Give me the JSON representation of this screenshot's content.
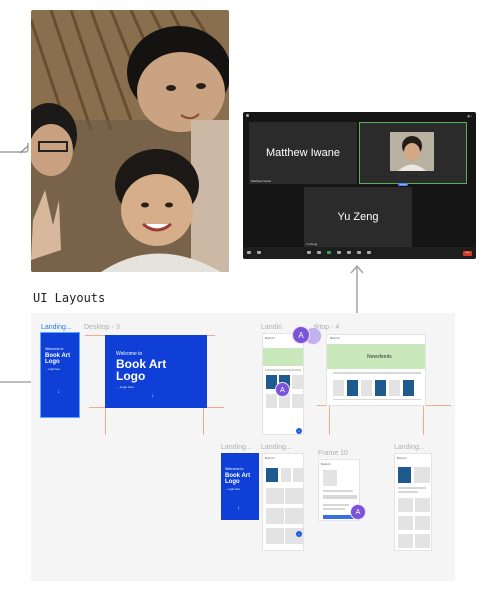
{
  "zoom": {
    "participants": [
      {
        "name": "Matthew Iwane"
      },
      {
        "name": "Yu Zeng"
      }
    ]
  },
  "section_title": "UI Layouts",
  "canvas": {
    "frames": {
      "landing_selected": {
        "label": "Landing..."
      },
      "desktop_3": {
        "label": "Desktop - 3"
      },
      "desktop_4_label_left": {
        "label": "Landin"
      },
      "desktop_4": {
        "label": "tktop - 4"
      },
      "landing_b": {
        "label": "Landing..."
      },
      "landing_c": {
        "label": "Landing..."
      },
      "frame_10": {
        "label": "Frame 10"
      },
      "landing_d": {
        "label": "Landing..."
      }
    },
    "landing_content": {
      "welcome": "Welcome to",
      "title": "Book Art Logo"
    },
    "desktop_banner": "Newsfeeds",
    "collaborator_initial": "A"
  },
  "colors": {
    "figma_blue": "#0f3fd6",
    "selection": "#1f7ef0",
    "avatar": "#7b53d6",
    "guide": "#f1a98f",
    "zoom_active_border": "#58b158"
  }
}
